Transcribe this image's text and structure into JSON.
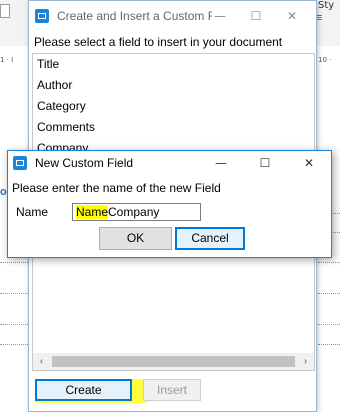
{
  "background": {
    "ruler_left": "1 · I",
    "ruler_right": "10 ·",
    "top_right_text": "Sty",
    "blue_mark": "o"
  },
  "main_dialog": {
    "title": "Create and Insert a Custom Fi...",
    "controls": {
      "minimize": "—",
      "maximize": "☐",
      "close": "✕"
    },
    "prompt": "Please select a field to insert in your document",
    "fields": [
      "Title",
      "Author",
      "Category",
      "Comments",
      "Company"
    ],
    "scroll_left": "‹",
    "scroll_right": "›",
    "create_label": "Create",
    "insert_label": "Insert"
  },
  "new_field_dialog": {
    "title": "New Custom Field",
    "controls": {
      "minimize": "—",
      "maximize": "☐",
      "close": "✕"
    },
    "prompt": "Please enter the name of the new Field",
    "name_label": "Name",
    "name_value_highlight": "Name",
    "name_value_rest": "Company",
    "ok_label": "OK",
    "cancel_label": "Cancel"
  },
  "colors": {
    "accent": "#0078d7",
    "title_icon": "#1a86d9",
    "highlight": "#ffff00"
  }
}
